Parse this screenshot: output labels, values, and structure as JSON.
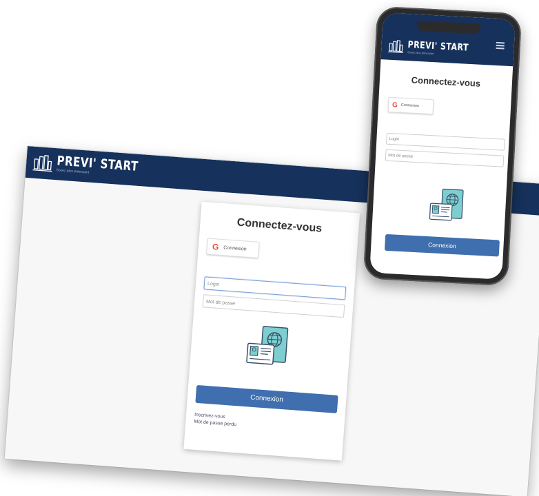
{
  "brand": {
    "name": "PREVI' START",
    "tagline": "Soyez plus prévoyant"
  },
  "desktop": {
    "title": "Connectez-vous",
    "google_button_label": "Connexion",
    "login_placeholder": "Login",
    "password_placeholder": "Mot de passe",
    "submit_label": "Connexion",
    "links": [
      "Inscrivez-vous",
      "Mot de passe perdu"
    ]
  },
  "mobile": {
    "title": "Connectez-vous",
    "google_button_label": "Connexion",
    "login_placeholder": "Login",
    "password_placeholder": "Mot de passe",
    "submit_label": "Connexion"
  },
  "icons": {
    "brand": "columns-logo-icon",
    "google": "google-icon",
    "menu": "hamburger-menu-icon",
    "illustration": "id-card-passport-illustration"
  },
  "colors": {
    "header": "#16325c",
    "primary": "#3f6fae",
    "illustration_teal": "#7dcfcf"
  }
}
